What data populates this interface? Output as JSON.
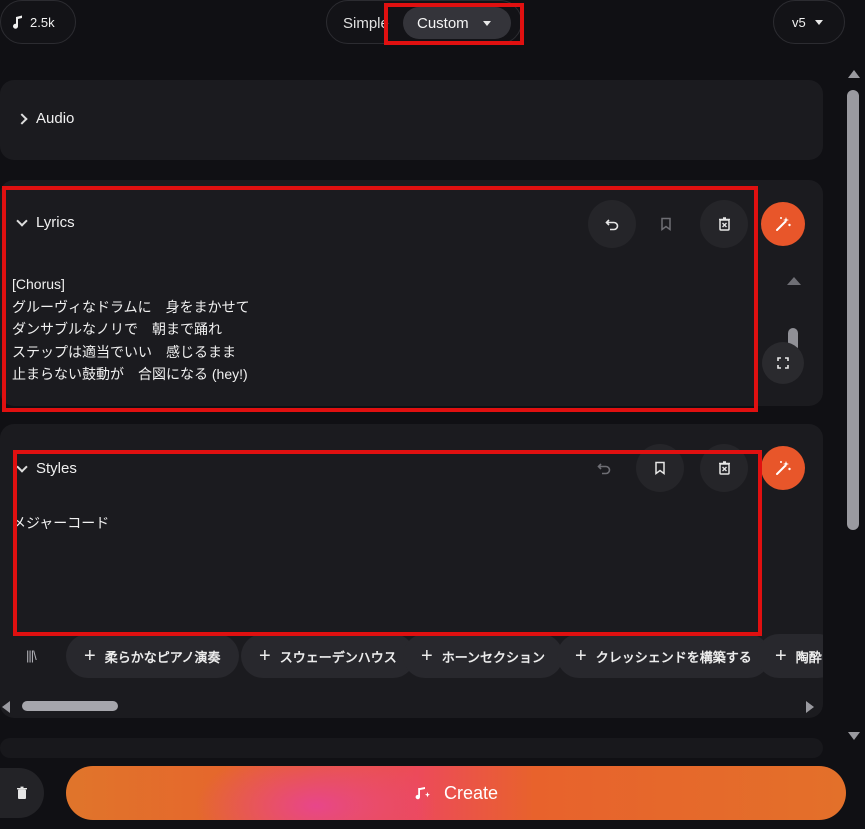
{
  "header": {
    "credits": "2.5k",
    "mode_tabs": [
      "Simple",
      "Custom"
    ],
    "active_mode": "Custom",
    "version": "v5"
  },
  "audio": {
    "label": "Audio"
  },
  "lyrics": {
    "label": "Lyrics",
    "text": "[Chorus]\nグルーヴィなドラムに　身をまかせて\nダンサブルなノリで　朝まで踊れ\nステップは適当でいい　感じるまま\n止まらない鼓動が　合図になる (hey!)"
  },
  "styles": {
    "label": "Styles",
    "text": "メジャーコード",
    "library_icon": "|||\\",
    "tags": [
      "柔らかなピアノ演奏",
      "スウェーデンハウス",
      "ホーンセクション",
      "クレッシェンドを構築する",
      "陶酔"
    ]
  },
  "footer": {
    "create_label": "Create"
  },
  "colors": {
    "accent": "#e8562a",
    "highlight": "#e01010",
    "card": "#1b1b1f",
    "background": "#101014"
  },
  "icons": [
    "music-note-icon",
    "caret-down-icon",
    "chevron-right-icon",
    "chevron-down-icon",
    "undo-icon",
    "bookmark-icon",
    "delete-icon",
    "magic-wand-icon",
    "expand-icon",
    "plus-icon",
    "trash-icon",
    "create-sparkle-icon"
  ]
}
